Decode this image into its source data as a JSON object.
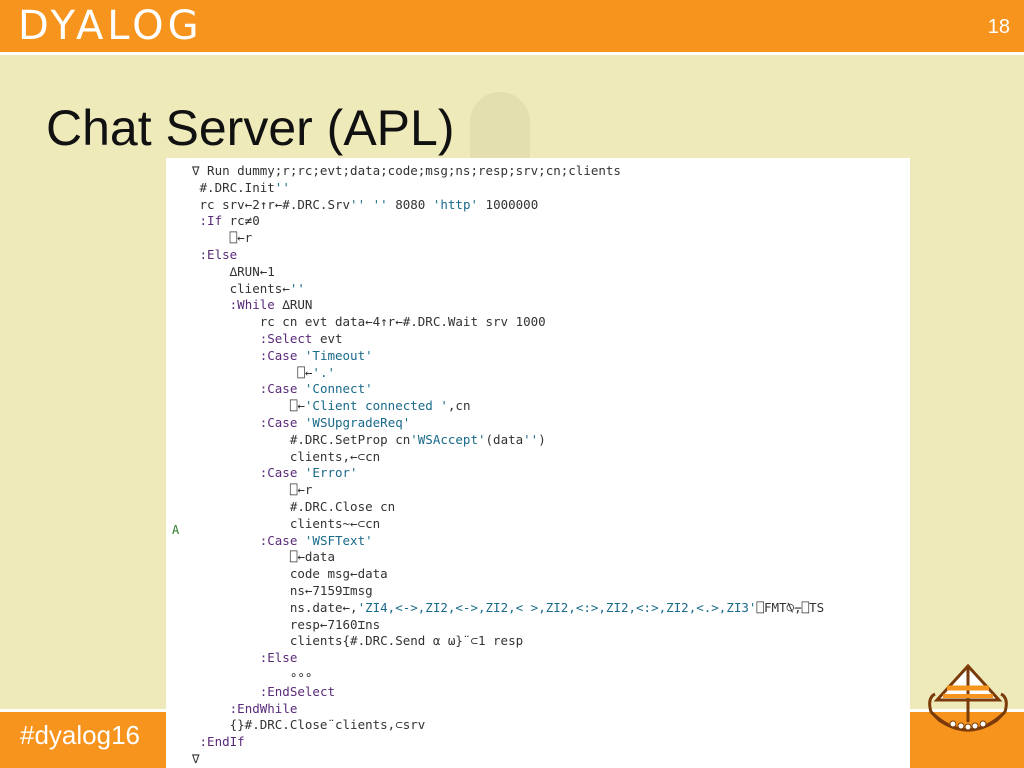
{
  "header": {
    "logo_text": "DYALOG",
    "slide_number": "18"
  },
  "slide": {
    "title": "Chat Server (APL)"
  },
  "footer": {
    "hashtag": "#dyalog16"
  },
  "code": {
    "gutter_mark": "A",
    "lines": [
      "∇ Run dummy;r;rc;evt;data;code;msg;ns;resp;srv;cn;clients",
      " #.DRC.Init''",
      " rc srv←2↑r←#.DRC.Srv'' '' 8080 'http' 1000000",
      " :If rc≠0",
      "     ⎕←r",
      " :Else",
      "     ∆RUN←1",
      "     clients←''",
      "     :While ∆RUN",
      "         rc cn evt data←4↑r←#.DRC.Wait srv 1000",
      "         :Select evt",
      "         :Case 'Timeout'",
      "              ⎕←'.'",
      "         :Case 'Connect'",
      "             ⎕←'Client connected ',cn",
      "         :Case 'WSUpgradeReq'",
      "             #.DRC.SetProp cn'WSAccept'(data'')",
      "             clients,←⊂cn",
      "         :Case 'Error'",
      "             ⎕←r",
      "             #.DRC.Close cn",
      "             clients~←⊂cn",
      "         :Case 'WSFText'",
      "             ⎕←data",
      "             code msg←data",
      "             ns←7159⌶msg",
      "             ns.date←,'ZI4,<->,ZI2,<->,ZI2,< >,ZI2,<:>,ZI2,<:>,ZI2,<.>,ZI3'⎕FMT⍉⍪⎕TS",
      "             resp←7160⌶ns",
      "             clients{#.DRC.Send ⍺ ⍵}¨⊂1 resp",
      "         :Else",
      "             ∘∘∘",
      "         :EndSelect",
      "     :EndWhile",
      "     {}#.DRC.Close¨clients,⊂srv",
      " :EndIf",
      "∇"
    ]
  },
  "colors": {
    "accent": "#f7941d",
    "background": "#efeaba",
    "keyword": "#5a2a7a",
    "string": "#1a6a8a",
    "name": "#333333"
  }
}
